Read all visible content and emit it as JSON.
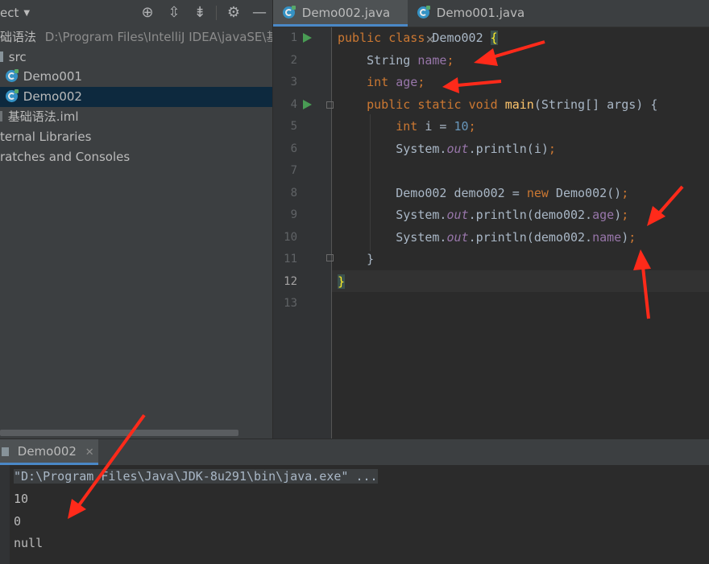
{
  "project": {
    "title": "ect",
    "root_name": "础语法",
    "root_path": "D:\\Program Files\\IntelliJ IDEA\\javaSE\\基础",
    "src": "src",
    "files": [
      "Demo001",
      "Demo002"
    ],
    "iml": "基础语法.iml",
    "ext_libs": "ternal Libraries",
    "scratches": "ratches and Consoles"
  },
  "editor": {
    "tabs": [
      {
        "label": "Demo002.java",
        "active": true
      },
      {
        "label": "Demo001.java",
        "active": false
      }
    ],
    "current_line": 12,
    "lines": [
      "public class Demo002 {",
      "    String name;",
      "    int age;",
      "    public static void main(String[] args) {",
      "        int i = 10;",
      "        System.out.println(i);",
      "",
      "        Demo002 demo002 = new Demo002();",
      "        System.out.println(demo002.age);",
      "        System.out.println(demo002.name);",
      "    }",
      "}",
      ""
    ]
  },
  "run": {
    "tab_label": "Demo002",
    "console": [
      "\"D:\\Program Files\\Java\\JDK-8u291\\bin\\java.exe\" ...",
      "10",
      "0",
      "null"
    ]
  },
  "colors": {
    "keyword": "#cc7832",
    "field": "#9876aa",
    "number": "#6897bb",
    "method": "#ffc66d",
    "annotation_arrow": "#ff2a1a"
  },
  "icons": [
    "locate-icon",
    "expand-all-icon",
    "collapse-all-icon",
    "gear-icon",
    "minimize-icon",
    "java-class-icon",
    "run-gutter-icon"
  ]
}
